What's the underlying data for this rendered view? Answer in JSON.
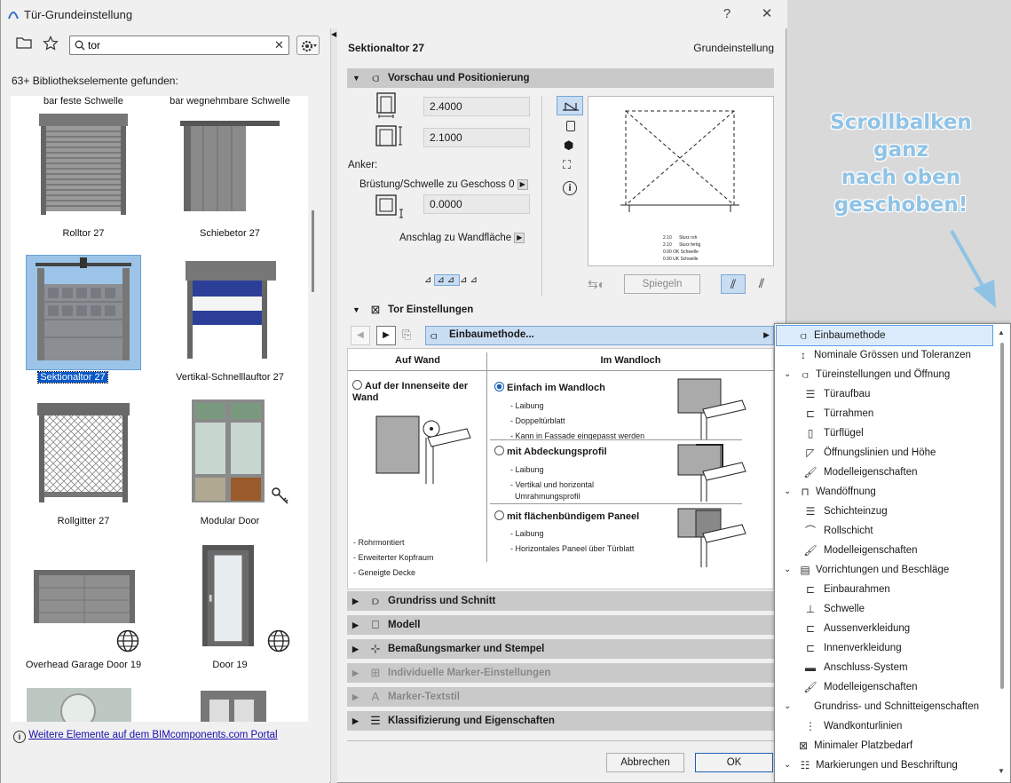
{
  "window": {
    "title": "Tür-Grundeinstellung",
    "help": "?",
    "close": "✕"
  },
  "library": {
    "search_value": "tor",
    "count": "63+ Bibliothekselemente gefunden:",
    "items": [
      {
        "label": "bar feste Schwelle"
      },
      {
        "label": "bar wegnehmbare Schwelle"
      },
      {
        "label": "Rolltor 27"
      },
      {
        "label": "Schiebetor 27"
      },
      {
        "label": "Sektionaltor 27"
      },
      {
        "label": "Vertikal-Schnelllauftor 27"
      },
      {
        "label": "Rollgitter 27"
      },
      {
        "label": "Modular Door"
      },
      {
        "label": "Overhead Garage Door 19"
      },
      {
        "label": "Door 19"
      }
    ],
    "portal_link": "Weitere Elemente auf dem BIMcomponents.com Portal"
  },
  "right": {
    "element": "Sektionaltor 27",
    "mode": "Grundeinstellung",
    "sections": {
      "preview": "Vorschau und Positionierung",
      "tor": "Tor Einstellungen",
      "grundriss": "Grundriss und Schnitt",
      "modell": "Modell",
      "bemassung": "Bemaßungsmarker und Stempel",
      "marker": "Individuelle Marker-Einstellungen",
      "textstil": "Marker-Textstil",
      "klass": "Klassifizierung und Eigenschaften"
    },
    "width": "2.4000",
    "height": "2.1000",
    "anker": "Anker:",
    "bruestung": "Brüstung/Schwelle zu Geschoss 0",
    "bruestung_value": "0.0000",
    "anschlag": "Anschlag zu Wandfläche",
    "spiegeln": "Spiegeln",
    "preview_notes": [
      "2.10      Sturz roh",
      "2.10      Sturz fertig",
      "0.00 OK Schwelle",
      "0.00 UK Schwelle"
    ],
    "dropdown_label": "Einbaumethode...",
    "tor_panel": {
      "col1": "Auf Wand",
      "col2": "Im Wandloch",
      "opt_wall": "Auf der Innenseite der Wand",
      "wall_notes": [
        "- Rohrmontiert",
        "- Erweiterter Kopfraum",
        "- Geneigte Decke"
      ],
      "opt1": "Einfach im Wandloch",
      "opt1_notes": [
        "- Laibung",
        "- Doppeltürblatt",
        "- Kann in Fassade eingepasst werden"
      ],
      "opt2": "mit Abdeckungsprofil",
      "opt2_notes": [
        "- Laibung",
        "- Vertikal und horizontal",
        "  Umrahmungsprofil"
      ],
      "opt3": "mit flächenbündigem Paneel",
      "opt3_notes": [
        "- Laibung",
        "- Horizontales Paneel über Türblatt"
      ]
    },
    "cancel": "Abbrechen",
    "ok": "OK"
  },
  "dropdown": [
    {
      "label": "Einbaumethode",
      "level": 1,
      "icon": "door-icon"
    },
    {
      "label": "Nominale Grössen und Toleranzen",
      "level": 1,
      "icon": "size-icon"
    },
    {
      "label": "Türeinstellungen und Öffnung",
      "level": 0,
      "icon": "door-icon"
    },
    {
      "label": "Türaufbau",
      "level": 2,
      "icon": "layers-icon"
    },
    {
      "label": "Türrahmen",
      "level": 2,
      "icon": "frame-icon"
    },
    {
      "label": "Türflügel",
      "level": 2,
      "icon": "leaf-icon"
    },
    {
      "label": "Öffnungslinien und Höhe",
      "level": 2,
      "icon": "opening-icon"
    },
    {
      "label": "Modelleigenschaften",
      "level": 2,
      "icon": "brush-icon"
    },
    {
      "label": "Wandöffnung",
      "level": 0,
      "icon": "wall-opening-icon"
    },
    {
      "label": "Schichteinzug",
      "level": 2,
      "icon": "layers-icon"
    },
    {
      "label": "Rollschicht",
      "level": 2,
      "icon": "arch-icon"
    },
    {
      "label": "Modelleigenschaften",
      "level": 2,
      "icon": "brush-icon"
    },
    {
      "label": "Vorrichtungen und Beschläge",
      "level": 0,
      "icon": "fixtures-icon"
    },
    {
      "label": "Einbaurahmen",
      "level": 2,
      "icon": "frame-icon"
    },
    {
      "label": "Schwelle",
      "level": 2,
      "icon": "sill-icon"
    },
    {
      "label": "Aussenverkleidung",
      "level": 2,
      "icon": "cladding-icon"
    },
    {
      "label": "Innenverkleidung",
      "level": 2,
      "icon": "cladding-icon"
    },
    {
      "label": "Anschluss-System",
      "level": 2,
      "icon": "truck-icon"
    },
    {
      "label": "Modelleigenschaften",
      "level": 2,
      "icon": "brush-icon"
    },
    {
      "label": "Grundriss- und Schnitteigenschaften",
      "level": 0,
      "icon": "none"
    },
    {
      "label": "Wandkonturlinien",
      "level": 2,
      "icon": "contour-icon"
    },
    {
      "label": "Minimaler Platzbedarf",
      "level": 1,
      "icon": "space-icon"
    },
    {
      "label": "Markierungen und Beschriftung",
      "level": 0,
      "icon": "marker-icon"
    }
  ],
  "annotation": [
    "Scrollbalken",
    "ganz",
    "nach oben",
    "geschoben!"
  ]
}
